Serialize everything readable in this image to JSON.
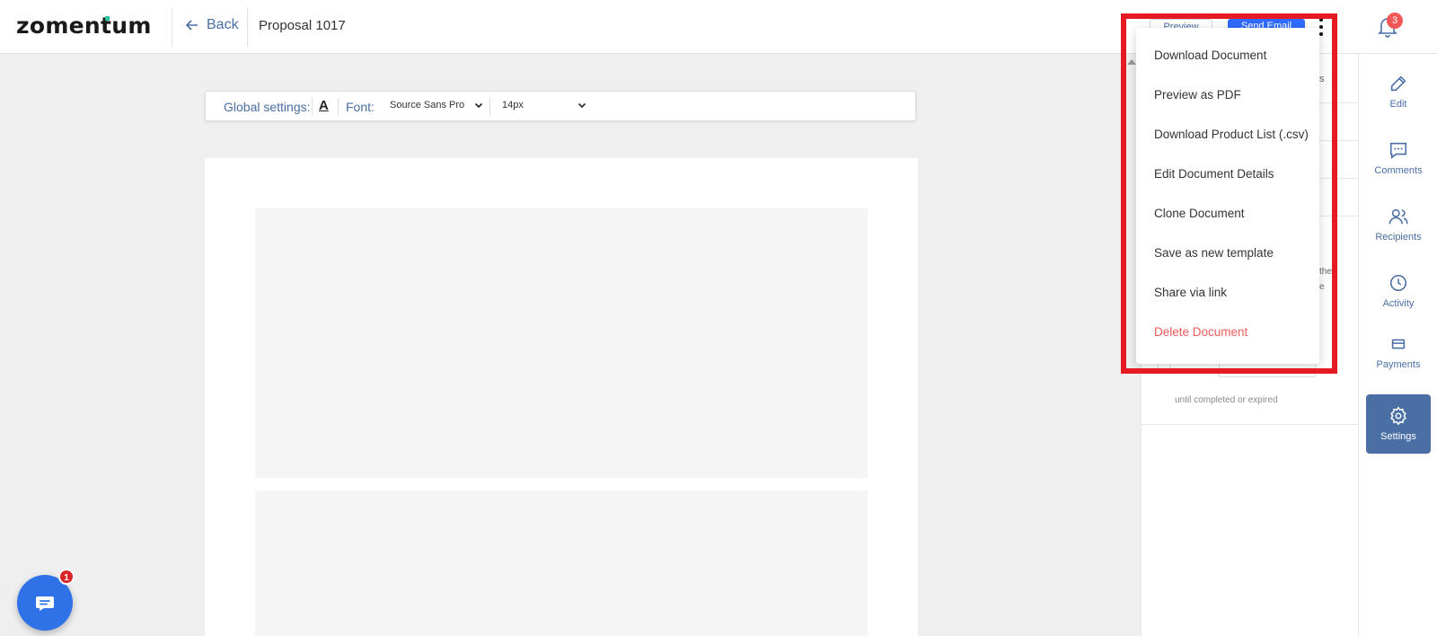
{
  "app": {
    "logo": "zomentum",
    "brand_accent": "#2cc3a0"
  },
  "header": {
    "back_label": "Back",
    "document_title": "Proposal 1017",
    "preview_label": "Preview",
    "send_label": "Send Email",
    "notification_count": "3"
  },
  "toolbar": {
    "global_label": "Global settings:",
    "text_color_glyph": "A",
    "font_label": "Font:",
    "font_value": "Source Sans Pro",
    "size_value": "14px"
  },
  "settings_panel": {
    "fragments": [
      "s",
      "the",
      "e"
    ],
    "note": "until completed or expired"
  },
  "rail": {
    "items": [
      {
        "label": "Edit",
        "icon": "pencil-icon"
      },
      {
        "label": "Comments",
        "icon": "comment-icon"
      },
      {
        "label": "Recipients",
        "icon": "users-icon"
      },
      {
        "label": "Activity",
        "icon": "clock-icon"
      },
      {
        "label": "Payments",
        "icon": "card-icon"
      },
      {
        "label": "Settings",
        "icon": "gear-icon",
        "active": true
      }
    ]
  },
  "menu": {
    "items": [
      {
        "label": "Download Document"
      },
      {
        "label": "Preview as PDF"
      },
      {
        "label": "Download Product List (.csv)"
      },
      {
        "label": "Edit Document Details"
      },
      {
        "label": "Clone Document"
      },
      {
        "label": "Save as new template"
      },
      {
        "label": "Share via link"
      },
      {
        "label": "Delete Document",
        "danger": true
      }
    ]
  },
  "chat": {
    "badge_count": "1"
  },
  "colors": {
    "accent": "#4a6fa5",
    "primary": "#2f6bff",
    "danger": "#ef5b5b",
    "highlight": "#e51a23"
  }
}
